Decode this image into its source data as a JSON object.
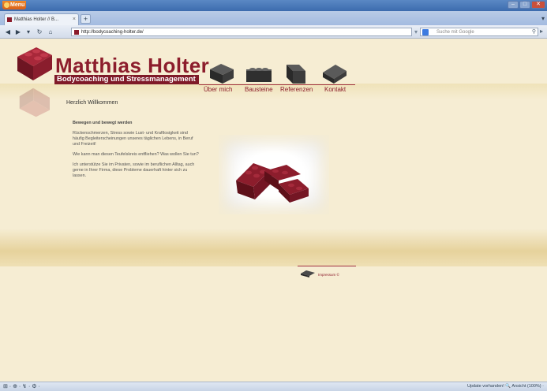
{
  "browser": {
    "menu_label": "Menu",
    "window_controls": {
      "minimize": "–",
      "maximize": "□",
      "close": "✕"
    },
    "tab": {
      "title": "Matthias Holter // B...",
      "close": "×"
    },
    "new_tab": "+",
    "tab_scroll": "▾",
    "nav": {
      "back": "◀",
      "forward": "▶",
      "dropdown": "▾",
      "reload": "↻",
      "home": "⌂"
    },
    "url": "http://bodycoaching-holter.de/",
    "url_star": "▾",
    "search_placeholder": "Suche mit Google",
    "search_icon": "⚲",
    "nav_right": "▸"
  },
  "site": {
    "brand_title": "Matthias Holter",
    "brand_subtitle": "Bodycoaching und Stressmanagement",
    "nav": [
      {
        "label": "Über mich"
      },
      {
        "label": "Bausteine"
      },
      {
        "label": "Referenzen"
      },
      {
        "label": "Kontakt"
      }
    ],
    "greeting": "Herzlich Willkommen",
    "content": {
      "heading": "Bewegen und bewegt werden",
      "p1": "Rückenschmerzen, Stress sowie Lust- und Kraftlosigkeit sind häufig Begleiterscheinungen unseres täglichen Lebens, in Beruf und Freizeit!",
      "p2": "Wie kann man diesen Teufelskreis entfliehen? Was wollen Sie tun?",
      "p3": "Ich unterstütze Sie im Privaten, sowie im beruflichen Alltag, auch gerne in Ihrer Firma, diese Probleme dauerhaft hinter sich zu lassen."
    },
    "footer_link": "Impressum ©"
  },
  "statusbar": {
    "left": "⊞ · ⊕ · ↯ · ⚙ ·",
    "right": "Update vorhanden!   🔍 Ansicht (100%) ·"
  },
  "colors": {
    "brand": "#8c1d2c",
    "page_bg": "#f6edd3"
  }
}
